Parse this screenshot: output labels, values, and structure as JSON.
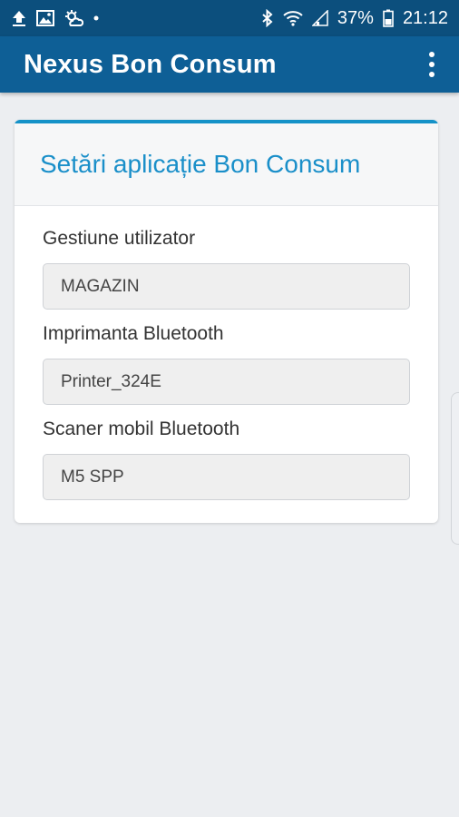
{
  "status_bar": {
    "battery": "37%",
    "time": "21:12",
    "icons": [
      "upload-icon",
      "image-icon",
      "weather-icon",
      "dot-icon",
      "bluetooth-icon",
      "wifi-icon",
      "signal-icon",
      "battery-icon"
    ]
  },
  "app_bar": {
    "title": "Nexus Bon Consum",
    "menu_icon": "more-vert-icon"
  },
  "settings_card": {
    "title": "Setări aplicație Bon Consum",
    "fields": [
      {
        "label": "Gestiune utilizator",
        "value": "MAGAZIN"
      },
      {
        "label": "Imprimanta Bluetooth",
        "value": "Printer_324E"
      },
      {
        "label": "Scaner mobil Bluetooth",
        "value": "M5 SPP"
      }
    ]
  },
  "colors": {
    "status_bar": "#0c4f7d",
    "app_bar": "#0e5f96",
    "accent": "#1a8fc9",
    "background": "#eceef1"
  }
}
